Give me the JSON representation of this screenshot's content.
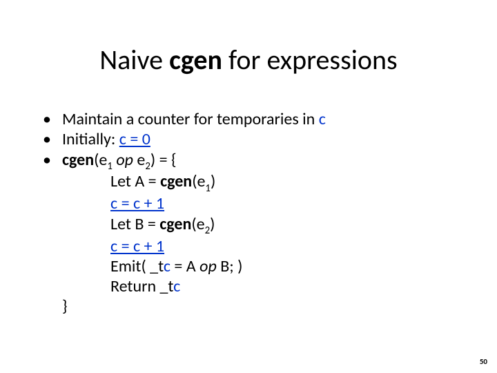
{
  "title": {
    "pre": "Naive ",
    "bold": "cgen",
    "post": " for expressions"
  },
  "b1": {
    "pre": "Maintain a counter for temporaries in ",
    "c": "c"
  },
  "b2": {
    "pre": "Initially: ",
    "eq": "c = 0"
  },
  "b3": {
    "cgen": "cgen",
    "lp": "(e",
    "s1": "1",
    "sp": " ",
    "op": "op",
    "sp2": " e",
    "s2": "2",
    "rp": ") = {"
  },
  "l1": {
    "pre": "Let A = ",
    "cgen": "cgen",
    "lp": "(e",
    "s1": "1",
    "rp": ")"
  },
  "l2": {
    "txt": "c = c + 1"
  },
  "l3": {
    "pre": "Let B = ",
    "cgen": "cgen",
    "lp": "(e",
    "s2": "2",
    "rp": ")"
  },
  "l4": {
    "txt": "c = c + 1"
  },
  "l5": {
    "pre": "Emit( _t",
    "c": "c",
    "mid": " = A ",
    "op": "op",
    "post": " B; )"
  },
  "l6": {
    "pre": "Return _t",
    "c": "c"
  },
  "close": "}",
  "page": "50"
}
